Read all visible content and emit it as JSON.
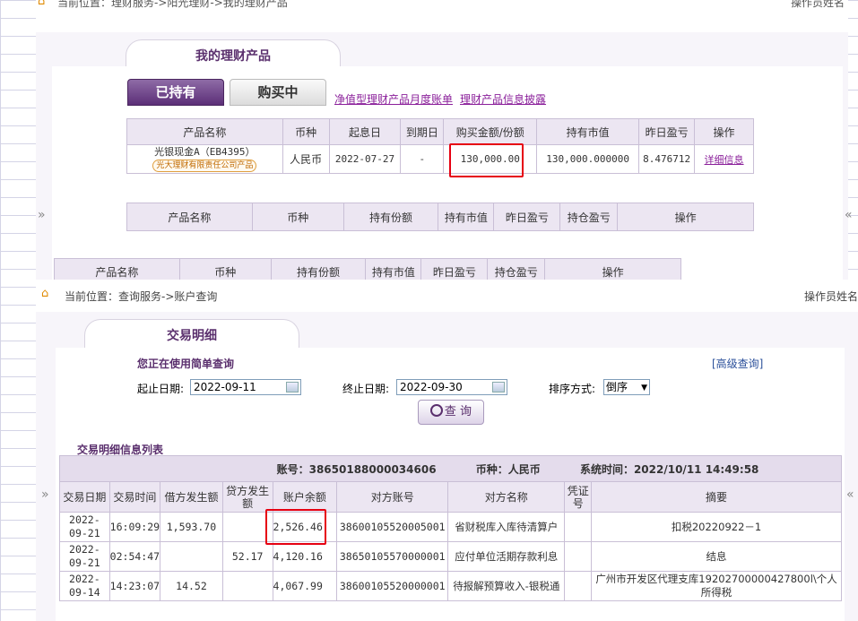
{
  "top": {
    "breadcrumb": "当前位置：理财服务->阳光理财->我的理财产品",
    "operator": "操作员姓名",
    "title": "我的理财产品",
    "tabs": [
      "已持有",
      "购买中"
    ],
    "links": [
      "净值型理财产品月度账单",
      "理财产品信息披露"
    ],
    "product_table": {
      "headers": [
        "产品名称",
        "币种",
        "起息日",
        "到期日",
        "购买金额/份额",
        "持有市值",
        "昨日盈亏",
        "操作"
      ],
      "rows": [
        {
          "name": "光银现金A（EB4395）",
          "issuer": "光大理财有限责任公司产品",
          "currency": "人民币",
          "start": "2022-07-27",
          "end": "-",
          "amount": "130,000.00",
          "market": "130,000.000000",
          "pnl": "8.476712",
          "action": "详细信息"
        }
      ]
    },
    "table2_headers": [
      "产品名称",
      "币种",
      "持有份额",
      "持有市值",
      "昨日盈亏",
      "持仓盈亏",
      "操作"
    ],
    "table3_headers": [
      "产品名称",
      "币种",
      "持有份额",
      "持有市值",
      "昨日盈亏",
      "持仓盈亏",
      "操作"
    ]
  },
  "bottom": {
    "breadcrumb": "当前位置：查询服务->账户查询",
    "operator": "操作员姓名",
    "title": "交易明细",
    "simple_query": "您正在使用简单查询",
    "advanced_query": "[高级查询]",
    "start_label": "起止日期:",
    "start_date": "2022-09-11",
    "end_label": "终止日期:",
    "end_date": "2022-09-30",
    "sort_label": "排序方式:",
    "sort_value": "倒序",
    "query_button": "查 询",
    "list_title": "交易明细信息列表",
    "info_account": "账号：38650188000034606",
    "info_currency": "币种：人民币",
    "info_time": "系统时间：2022/10/11 14:49:58",
    "headers": [
      "交易日期",
      "交易时间",
      "借方发生额",
      "贷方发生额",
      "账户余额",
      "对方账号",
      "对方名称",
      "凭证号",
      "摘要"
    ],
    "rows": [
      {
        "date": "2022-09-21",
        "time": "16:09:29",
        "debit": "1,593.70",
        "credit": "",
        "balance": "2,526.46",
        "acct": "38600105520005001",
        "name": "省财税库入库待清算户",
        "voucher": "",
        "memo": "扣税20220922－1"
      },
      {
        "date": "2022-09-21",
        "time": "02:54:47",
        "debit": "",
        "credit": "52.17",
        "balance": "4,120.16",
        "acct": "38650105570000001",
        "name": "应付单位活期存款利息",
        "voucher": "",
        "memo": "结息"
      },
      {
        "date": "2022-09-14",
        "time": "14:23:07",
        "debit": "14.52",
        "credit": "",
        "balance": "4,067.99",
        "acct": "38600105520000001",
        "name": "待报解预算收入-银税通",
        "voucher": "",
        "memo": "广州市开发区代理支库19202700000427800l\\个人所得税"
      }
    ]
  },
  "icons": {
    "home": "home-icon",
    "calendar": "calendar-icon",
    "search": "search-icon",
    "collapse": "collapse-arrow-icon"
  }
}
